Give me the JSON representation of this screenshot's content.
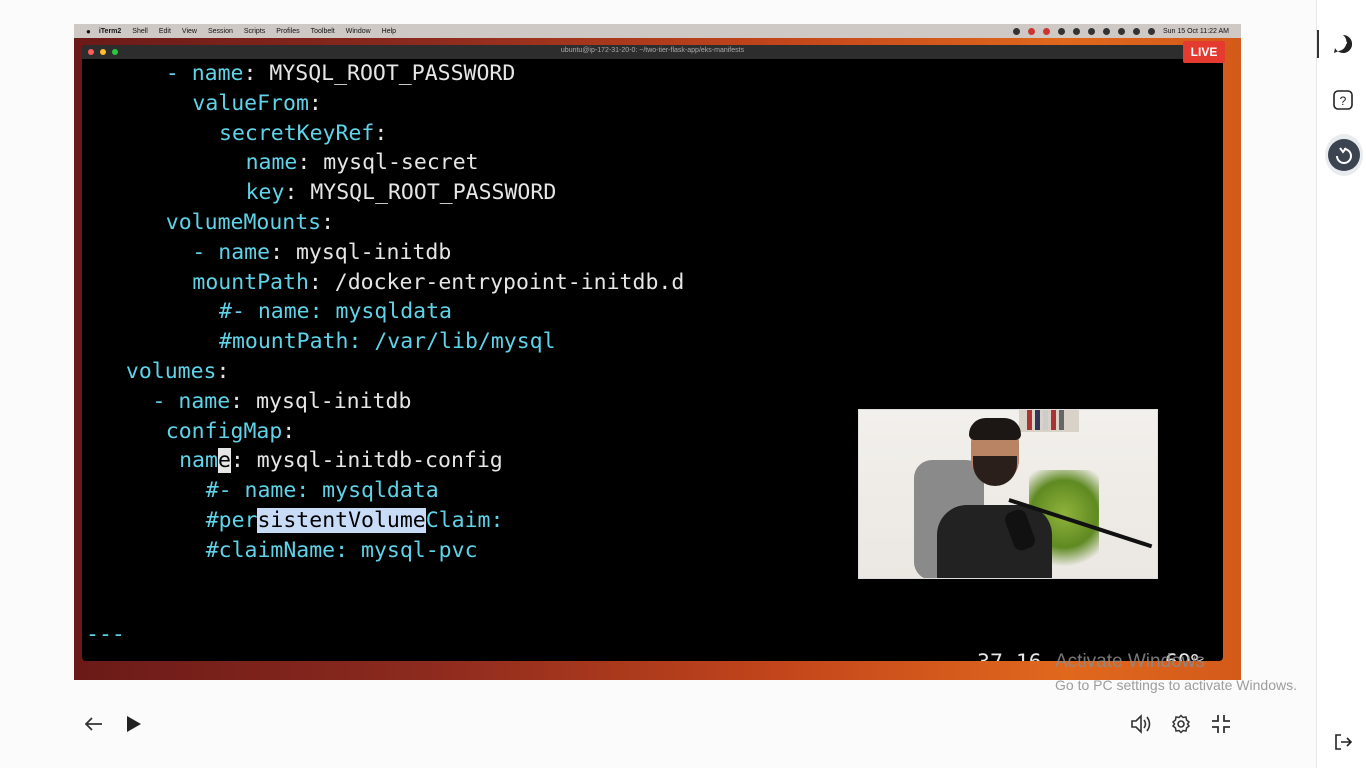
{
  "mac_menubar": {
    "app": "iTerm2",
    "items": [
      "Shell",
      "Edit",
      "View",
      "Session",
      "Scripts",
      "Profiles",
      "Toolbelt",
      "Window",
      "Help"
    ],
    "clock": "Sun 15 Oct  11:22 AM"
  },
  "iterm": {
    "title": "ubuntu@ip-172-31-20-0: ~/two-tier-flask-app/eks-manifests"
  },
  "live_badge": "LIVE",
  "editor": {
    "lines": [
      {
        "indent": "      ",
        "dash": "- ",
        "key": "name",
        "sep": ": ",
        "val": "MYSQL_ROOT_PASSWORD"
      },
      {
        "indent": "        ",
        "dash": "",
        "key": "valueFrom",
        "sep": ":",
        "val": ""
      },
      {
        "indent": "          ",
        "dash": "",
        "key": "secretKeyRef",
        "sep": ":",
        "val": ""
      },
      {
        "indent": "            ",
        "dash": "",
        "key": "name",
        "sep": ": ",
        "val": "mysql-secret"
      },
      {
        "indent": "            ",
        "dash": "",
        "key": "key",
        "sep": ": ",
        "val": "MYSQL_ROOT_PASSWORD"
      },
      {
        "indent": "      ",
        "dash": "",
        "key": "volumeMounts",
        "sep": ":",
        "val": ""
      },
      {
        "indent": "        ",
        "dash": "- ",
        "key": "name",
        "sep": ": ",
        "val": "mysql-initdb"
      },
      {
        "indent": "        ",
        "dash": "",
        "key": "mountPath",
        "sep": ": ",
        "val": "/docker-entrypoint-initdb.d"
      },
      {
        "indent": "          ",
        "comment": "#- name: mysqldata"
      },
      {
        "indent": "          ",
        "comment": "#mountPath: /var/lib/mysql"
      },
      {
        "indent": "   ",
        "dash": "",
        "key": "volumes",
        "sep": ":",
        "val": ""
      },
      {
        "indent": "     ",
        "dash": "- ",
        "key": "name",
        "sep": ": ",
        "val": "mysql-initdb"
      },
      {
        "indent": "      ",
        "dash": "",
        "key": "configMap",
        "sep": ":",
        "val": ""
      },
      {
        "indent": "       ",
        "special": "cursor",
        "pre": "nam",
        "cur": "e",
        "sep": ": ",
        "val": "mysql-initdb-config"
      },
      {
        "indent": "         ",
        "comment": "#- name: mysqldata"
      },
      {
        "indent": "         ",
        "special": "selection",
        "pre": "#per",
        "sel": "sistentVolume",
        "post": "Claim:"
      },
      {
        "indent": "         ",
        "comment": "#claimName: mysql-pvc"
      }
    ],
    "separator": "---",
    "status_position": "37,16",
    "status_percent": "69%"
  },
  "watermark": {
    "line1": "Activate Windows",
    "line2": "Go to PC settings to activate Windows."
  },
  "controls": {
    "back_icon": "arrow-left-icon",
    "play_icon": "play-icon",
    "volume_icon": "volume-icon",
    "settings_icon": "gear-icon",
    "exit_fullscreen_icon": "collapse-icon"
  },
  "sidebar": {
    "chat_icon": "chat-icon",
    "help_icon": "question-icon",
    "raise_hand_icon": "raise-hand-icon",
    "exit_icon": "exit-icon"
  }
}
